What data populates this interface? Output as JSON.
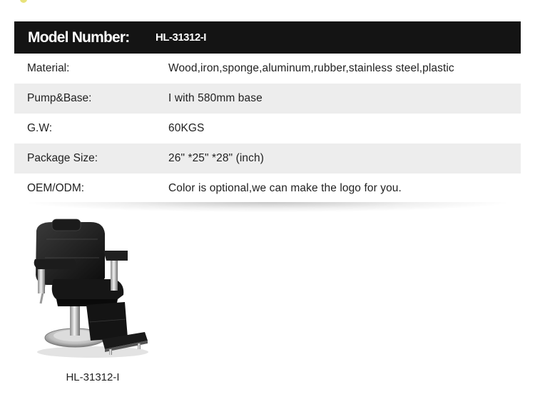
{
  "spec_table": {
    "header": {
      "label": "Model Number:",
      "value": "HL-31312-I"
    },
    "rows": [
      {
        "label": "Material:",
        "value": "Wood,iron,sponge,aluminum,rubber,stainless steel,plastic"
      },
      {
        "label": "Pump&Base:",
        "value": "I with 580mm base"
      },
      {
        "label": "G.W:",
        "value": "60KGS"
      },
      {
        "label": "Package Size:",
        "value": "26\" *25\" *28\" (inch)"
      },
      {
        "label": "OEM/ODM:",
        "value": "Color is optional,we can make the logo for you."
      }
    ]
  },
  "product": {
    "caption": "HL-31312-I",
    "image": "black barber chair with footrest and chrome round base"
  },
  "colors": {
    "header_background": "#141414",
    "row_stripe": "#ededed",
    "text": "#222222"
  }
}
